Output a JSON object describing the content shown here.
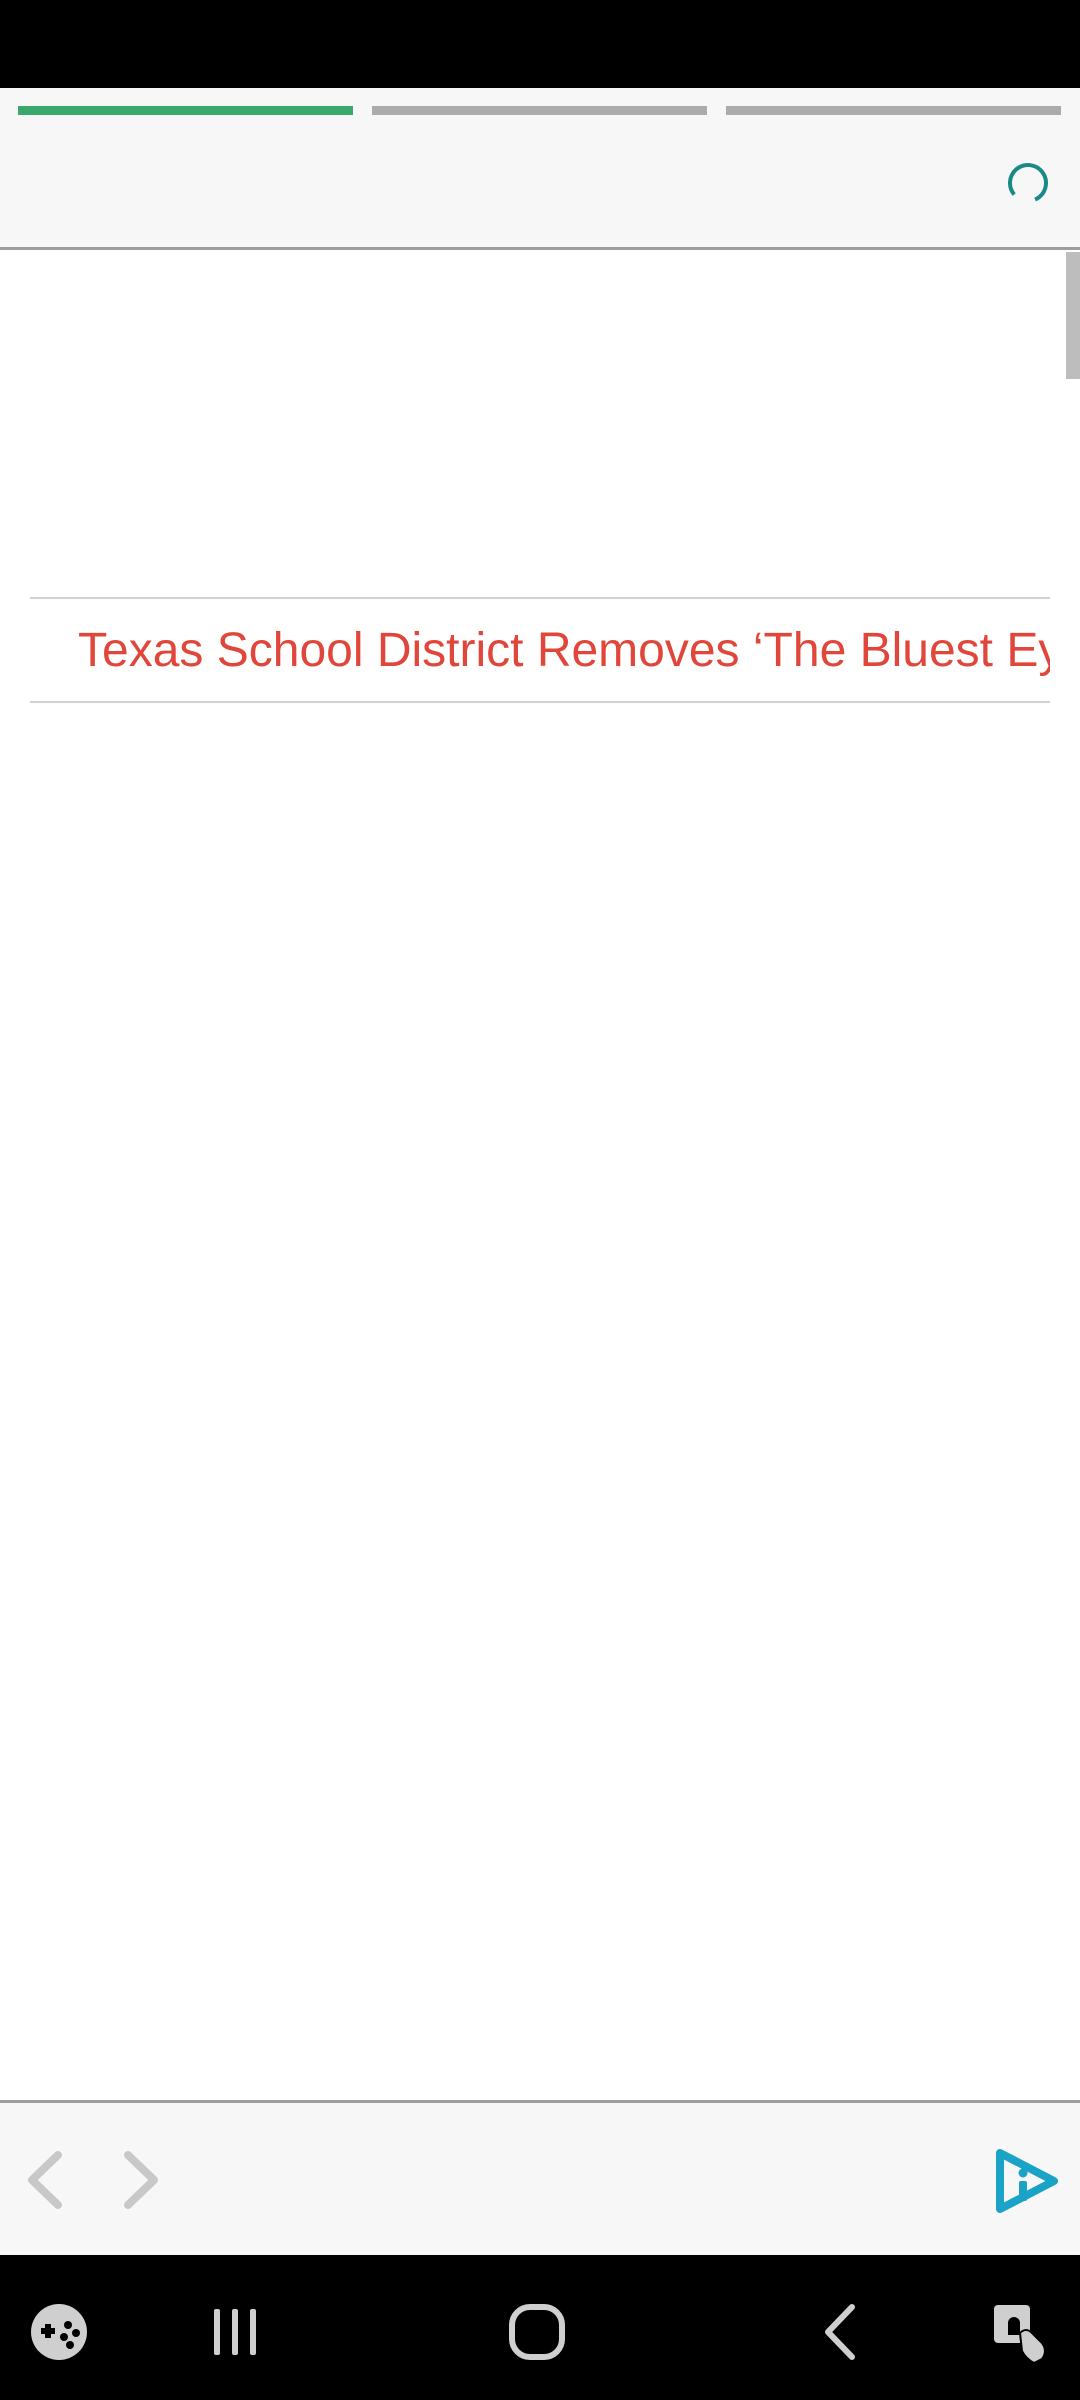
{
  "status_bar": {},
  "top_area": {
    "progress_segments": [
      {
        "name": "segment-1",
        "progress": 1.0,
        "color": "#3aa86b"
      },
      {
        "name": "segment-2",
        "progress": 0.0,
        "color": "#ababab"
      },
      {
        "name": "segment-3",
        "progress": 0.0,
        "color": "#ababab"
      }
    ],
    "spinner_icon": "loading-spinner-icon",
    "accent_color": "#1a8a86"
  },
  "content": {
    "headline": "Texas School District Removes ‘The Bluest Ey",
    "headline_color": "#e0463a"
  },
  "bottom_bar": {
    "back_icon": "chevron-left-icon",
    "forward_icon": "chevron-right-icon",
    "brand_icon": "play-info-icon",
    "brand_color": "#1aa3c6"
  },
  "system_nav": {
    "items": [
      "game-tools-icon",
      "recent-apps-icon",
      "home-icon",
      "back-icon",
      "accessibility-icon"
    ]
  }
}
